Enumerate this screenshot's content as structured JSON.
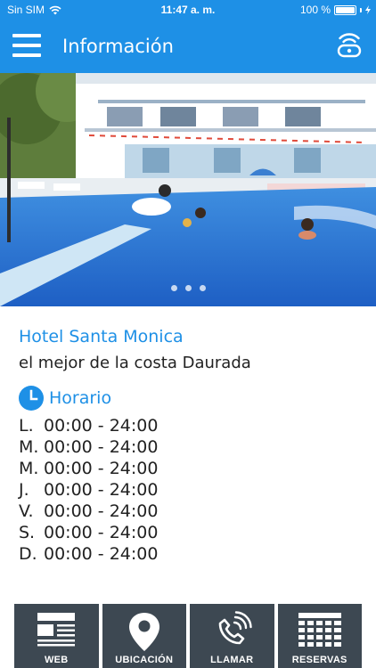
{
  "status_bar": {
    "carrier": "Sin SIM",
    "time": "11:47 a. m.",
    "battery": "100 %"
  },
  "nav": {
    "title": "Información",
    "menu_icon": "hamburger-icon",
    "right_icon": "wifi-icon"
  },
  "hero": {
    "carousel_pages": 3
  },
  "info": {
    "hotel_name": "Hotel Santa Monica",
    "slogan": "el mejor de la costa Daurada",
    "horario_title": "Horario"
  },
  "schedule": [
    {
      "day": "L.",
      "hours": "00:00 - 24:00"
    },
    {
      "day": "M.",
      "hours": "00:00 - 24:00"
    },
    {
      "day": "M.",
      "hours": "00:00 - 24:00"
    },
    {
      "day": "J.",
      "hours": "00:00 - 24:00"
    },
    {
      "day": "V.",
      "hours": "00:00 - 24:00"
    },
    {
      "day": "S.",
      "hours": "00:00 - 24:00"
    },
    {
      "day": "D.",
      "hours": "00:00 - 24:00"
    }
  ],
  "actions": [
    {
      "label": "WEB",
      "icon": "web-page-icon"
    },
    {
      "label": "UBICACIÓN",
      "icon": "location-pin-icon"
    },
    {
      "label": "LLAMAR",
      "icon": "phone-icon"
    },
    {
      "label": "RESERVAS",
      "icon": "calendar-icon"
    }
  ],
  "colors": {
    "primary": "#1e90e6",
    "button_bg": "#3d4852",
    "text": "#222222"
  }
}
